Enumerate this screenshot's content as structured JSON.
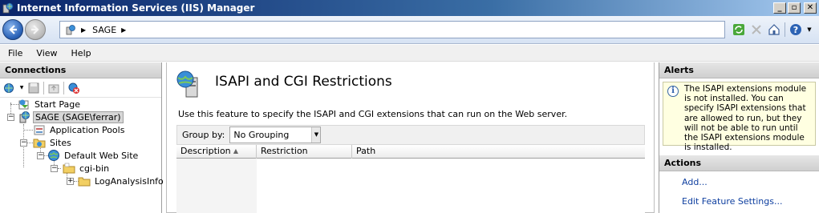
{
  "window": {
    "title": "Internet Information Services (IIS) Manager",
    "buttons": {
      "minimize": "_",
      "restore": "▫",
      "close": "✕"
    }
  },
  "address": {
    "crumbs": [
      "SAGE"
    ]
  },
  "menu": [
    "File",
    "View",
    "Help"
  ],
  "connections": {
    "header": "Connections",
    "tree": [
      {
        "label": "Start Page",
        "icon": "start-page-icon"
      },
      {
        "label": "SAGE (SAGE\\ferrar)",
        "icon": "server-icon",
        "selected": true
      },
      {
        "label": "Application Pools",
        "icon": "app-pools-icon"
      },
      {
        "label": "Sites",
        "icon": "sites-icon"
      },
      {
        "label": "Default Web Site",
        "icon": "globe-icon"
      },
      {
        "label": "cgi-bin",
        "icon": "folder-icon"
      },
      {
        "label": "LogAnalysisInfo",
        "icon": "folder-icon"
      }
    ]
  },
  "feature": {
    "title": "ISAPI and CGI Restrictions",
    "description": "Use this feature to specify the ISAPI and CGI extensions that can run on the Web server.",
    "group_by_label": "Group by:",
    "group_by_value": "No Grouping",
    "columns": [
      "Description",
      "Restriction",
      "Path"
    ]
  },
  "alerts": {
    "header": "Alerts",
    "message": "The ISAPI extensions module is not installed. You can specify ISAPI extensions that are allowed to run, but they will not be able to run until the ISAPI extensions module is installed."
  },
  "actions": {
    "header": "Actions",
    "items": [
      "Add...",
      "Edit Feature Settings..."
    ]
  }
}
